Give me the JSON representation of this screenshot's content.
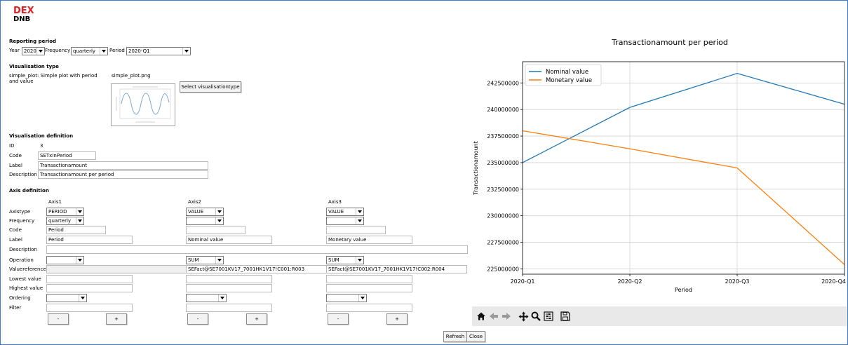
{
  "brand": {
    "line1": "DEX",
    "line2": "DNB"
  },
  "reporting_period": {
    "header": "Reporting period",
    "year_label": "Year",
    "year_value": "2020",
    "frequency_label": "Frequency",
    "frequency_value": "quarterly",
    "period_label": "Period",
    "period_value": "2020-Q1"
  },
  "visualisation_type": {
    "header": "Visualisation type",
    "description": [
      "simple_plot: Simple plot with period",
      "and value"
    ],
    "image_name": "simple_plot.png",
    "select_button": "Select visualisationtype"
  },
  "visualisation_definition": {
    "header": "Visualisation definition",
    "id_label": "ID",
    "id_value": "3",
    "code_label": "Code",
    "code_value": "SETxInPeriod",
    "label_label": "Label",
    "label_value": "Transactionamount",
    "description_label": "Description",
    "description_value": "Transactionamount per period"
  },
  "axis_definition": {
    "header": "Axis definition",
    "row_labels": {
      "axistype": "Axistype",
      "frequency": "Frequency",
      "code": "Code",
      "label": "Label",
      "description": "Description",
      "operation": "Operation",
      "valuereference": "Valuereference",
      "lowest": "Lowest value",
      "highest": "Highest value",
      "ordering": "Ordering",
      "filter": "Filter"
    },
    "axes": [
      {
        "title": "Axis1",
        "axistype": "PERIOD",
        "frequency": "quarterly",
        "code": "Period",
        "label": "Period",
        "description": "",
        "operation": "",
        "valuereference": "",
        "lowest": "",
        "highest": "",
        "ordering": "",
        "filter": "",
        "minus": "-",
        "plus": "+"
      },
      {
        "title": "Axis2",
        "axistype": "VALUE",
        "frequency": "",
        "code": "",
        "label": "Nominal value",
        "description": "",
        "operation": "SUM",
        "valuereference": "SEFact@SE7001KV17_7001HK1V17!C001:R003",
        "lowest": "",
        "highest": "",
        "ordering": "",
        "filter": "",
        "minus": "-",
        "plus": "+"
      },
      {
        "title": "Axis3",
        "axistype": "VALUE",
        "frequency": "",
        "code": "",
        "label": "Monetary value",
        "description": "",
        "operation": "SUM",
        "valuereference": "SEFact@SE7001KV17_7001HK1V17!C002:R004",
        "lowest": "",
        "highest": "",
        "ordering": "",
        "filter": "",
        "minus": "-",
        "plus": "+"
      }
    ]
  },
  "footer": {
    "refresh": "Refresh",
    "close": "Close"
  },
  "toolbar_icons": [
    "home-icon",
    "back-arrow-icon",
    "forward-arrow-icon",
    "pan-icon",
    "zoom-icon",
    "subplots-config-icon",
    "save-icon"
  ],
  "colors": {
    "nominal": "#1f77b4",
    "monetary": "#ff7f0e",
    "brand_red": "#e02020"
  },
  "chart_data": {
    "type": "line",
    "title": "Transactionamount per period",
    "xlabel": "Period",
    "ylabel": "Transactionamount",
    "categories": [
      "2020-Q1",
      "2020-Q2",
      "2020-Q3",
      "2020-Q4"
    ],
    "series": [
      {
        "name": "Nominal value",
        "values": [
          235000000,
          240200000,
          243400000,
          240500000
        ],
        "color": "#1f77b4"
      },
      {
        "name": "Monetary value",
        "values": [
          238000000,
          236300000,
          234500000,
          225400000
        ],
        "color": "#ff7f0e"
      }
    ],
    "ylim": [
      224500000,
      244500000
    ],
    "yticks": [
      225000000,
      227500000,
      230000000,
      232500000,
      235000000,
      237500000,
      240000000,
      242500000
    ],
    "grid": true,
    "legend": "top-left"
  }
}
